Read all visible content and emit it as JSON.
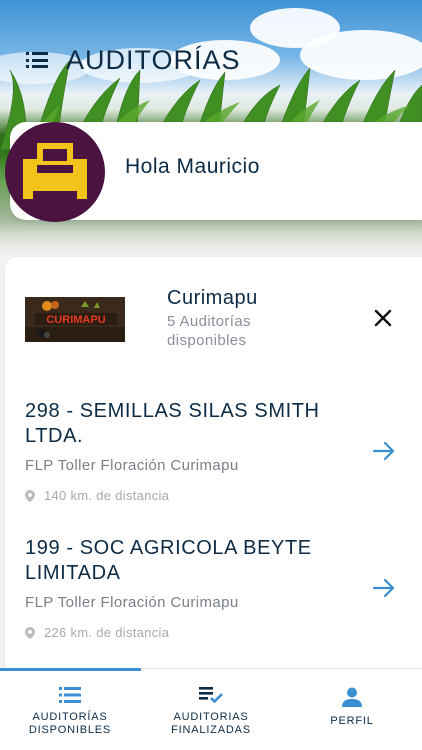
{
  "header": {
    "title": "AUDITORÍAS",
    "menu_icon": "menu-list-icon"
  },
  "greeting": {
    "text": "Hola Mauricio",
    "avatar_icon": "sofa-icon",
    "avatar_color": "#4a1340",
    "avatar_accent": "#f2c318"
  },
  "company": {
    "name": "Curimapu",
    "available": "5 Auditorías disponibles",
    "logo_text": "CURIMAPU"
  },
  "audits": [
    {
      "title": "298 - SEMILLAS SILAS SMITH LTDA.",
      "description": "FLP Toller Floración Curimapu",
      "distance": "140 km. de distancia"
    },
    {
      "title": "199 - SOC AGRICOLA BEYTE LIMITADA",
      "description": "FLP Toller Floración Curimapu",
      "distance": "226 km. de distancia"
    }
  ],
  "nav": {
    "items": [
      {
        "label": "AUDITORÍAS DISPONIBLES",
        "icon": "list-icon",
        "active": true
      },
      {
        "label": "AUDITORIAS FINALIZADAS",
        "icon": "checklist-icon",
        "active": false
      },
      {
        "label": "PERFIL",
        "icon": "person-icon",
        "active": false
      }
    ]
  },
  "colors": {
    "primary_text": "#0d2b45",
    "accent": "#3a8fd0",
    "muted": "#8a9099"
  }
}
